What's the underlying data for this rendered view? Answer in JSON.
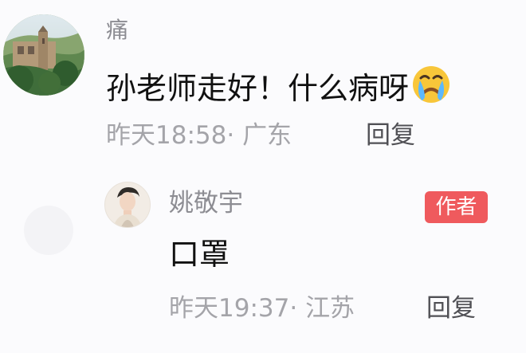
{
  "comment": {
    "username": "痛",
    "text": "孙老师走好！什么病呀",
    "emoji": "loudly-crying-face-icon",
    "time": "昨天18:58",
    "location": "广东",
    "reply_label": "回复"
  },
  "reply": {
    "username": "姚敬宇",
    "badge": "作者",
    "text": "口罩",
    "time": "昨天19:37",
    "location": "江苏",
    "reply_label": "回复"
  },
  "colors": {
    "badge": "#ef5a5d",
    "meta": "#a4a4a9",
    "username": "#8d8d93"
  }
}
